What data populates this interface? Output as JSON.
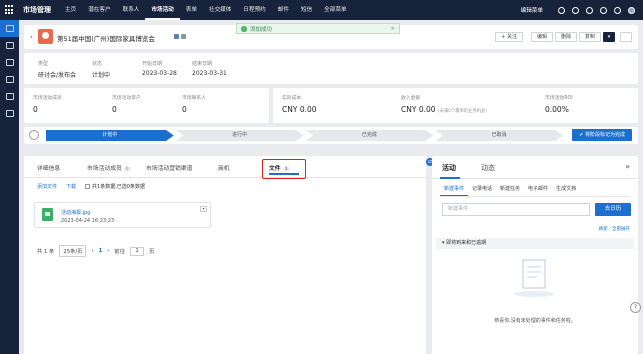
{
  "topbar": {
    "app_title": "市场管理",
    "nav": [
      "主页",
      "潜在客户",
      "联系人",
      "市场活动",
      "表单",
      "社交媒体",
      "日程预约",
      "邮件",
      "短信",
      "全部菜单"
    ],
    "active_index": 3,
    "edit_menu": "编辑菜单"
  },
  "toast": {
    "message": "添加成功",
    "close": "×"
  },
  "header": {
    "title": "第51届中国(广州)国际家具博览会",
    "follow": "+ 关注",
    "edit": "编辑",
    "delete": "删除",
    "copy": "复制"
  },
  "info": {
    "type_label": "类型",
    "type_value": "研讨会/发布会",
    "status_label": "状态",
    "status_value": "计划中",
    "start_label": "开始日期",
    "start_value": "2023-03-28",
    "end_label": "结束日期",
    "end_value": "2023-03-31"
  },
  "metrics": {
    "m1_label": "市场活动成员",
    "m1_value": "0",
    "m2_label": "市场活动客户",
    "m2_value": "0",
    "m3_label": "市场联系人",
    "m3_value": "0",
    "m4_label": "实际成本",
    "m4_value": "CNY 0.00",
    "m5_label": "收入金额",
    "m5_value": "CNY 0.00",
    "m5_sub": "(未满0个赢单的业务机会)",
    "m6_label": "市场活动ROI",
    "m6_value": "0.00%"
  },
  "stages": {
    "items": [
      "计划中",
      "进行中",
      "已完成",
      "已取消"
    ],
    "mark_done": "✔ 将阶段标记为完成"
  },
  "tabs": {
    "details": "详细信息",
    "members": "市场活动成员",
    "members_count": "0",
    "channels": "市场活动营销渠道",
    "opportunities": "商机",
    "files": "文件",
    "files_count": "1"
  },
  "files_toolbar": {
    "add": "添加文件",
    "download": "下载",
    "summary": "共1条数据,已选0条数据"
  },
  "file": {
    "name": "活动海报.jpg",
    "date": "2023-04-24 16:23:23",
    "menu": "▾"
  },
  "pager": {
    "total": "共 1 条",
    "per_page": "25条/页",
    "prev": "‹",
    "page": "1",
    "next": "›",
    "goto": "前往",
    "goto_value": "1",
    "page_unit": "页"
  },
  "activity": {
    "tab_activity": "活动",
    "tab_dynamic": "动态",
    "expand": "»",
    "subtabs": [
      "新建事件",
      "记录电话",
      "新建任务",
      "电子邮件",
      "生成文档"
    ],
    "log_placeholder": "新建事件",
    "log_button": "去日历",
    "filter_links": "刷新 · 全部展开",
    "section": "▾ 即将到来和已逾期",
    "empty": "恭喜你,没有未处理的事件和任务啦。"
  }
}
